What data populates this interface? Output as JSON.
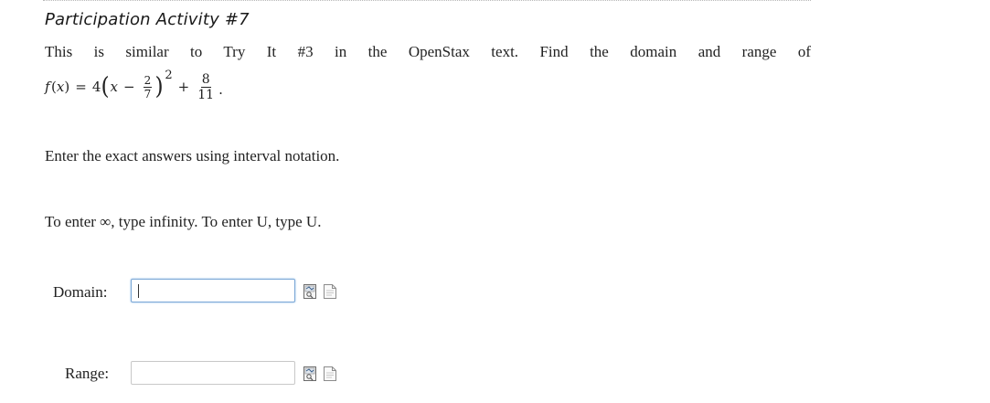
{
  "activity": {
    "title": "Participation Activity #7"
  },
  "question": {
    "intro": "This is similar to Try It #3 in the OpenStax text. Find the domain and range of",
    "formula": {
      "fname": "f",
      "var": "x",
      "coef": "4",
      "inner_num": "2",
      "inner_den": "7",
      "exponent": "2",
      "const_num": "8",
      "const_den": "11"
    },
    "instruction_exact": "Enter the exact answers using interval notation.",
    "instruction_symbols": "To enter ∞, type infinity. To enter U, type U."
  },
  "answers": {
    "domain": {
      "label": "Domain:",
      "value": ""
    },
    "range": {
      "label": "Range:",
      "value": ""
    }
  },
  "icons": {
    "preview": "preview-icon",
    "help": "help-document-icon"
  }
}
